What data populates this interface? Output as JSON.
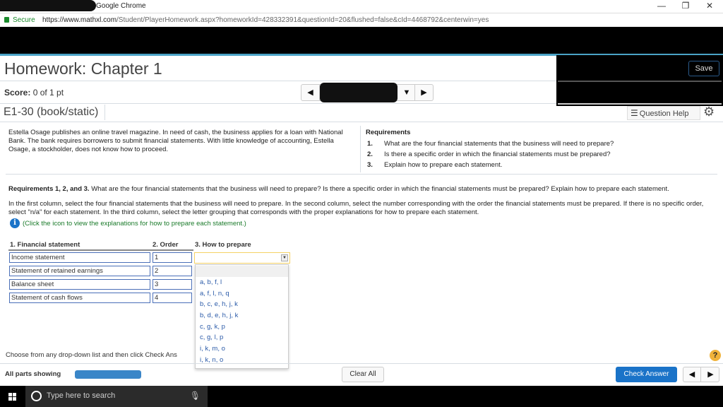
{
  "browser": {
    "window_title": "Google Chrome",
    "secure_label": "Secure",
    "url_domain": "https://www.mathxl.com",
    "url_path": "/Student/PlayerHomework.aspx?homeworkId=428332391&questionId=20&flushed=false&cId=4468792&centerwin=yes",
    "controls": {
      "minimize": "—",
      "restore": "❐",
      "close": "✕"
    }
  },
  "header": {
    "title": "Homework: Chapter 1",
    "save_label": "Save",
    "score_label": "Score:",
    "score_value": "0 of 1 pt",
    "question_id": "E1-30 (book/static)",
    "question_help_label": "Question Help",
    "question_help_icon": "list-icon",
    "settings_icon": "gear-icon",
    "prev_icon": "◀",
    "next_icon": "▶",
    "dropdown_icon": "▼"
  },
  "problem": {
    "story": "Estella Osage publishes an online travel magazine. In need of cash, the business applies for a loan with National Bank. The bank requires borrowers to submit financial statements. With little knowledge of accounting, Estella Osage, a stockholder, does not know how to proceed.",
    "requirements_title": "Requirements",
    "requirements": [
      {
        "num": "1.",
        "text": "What are the four financial statements that the business will need to prepare?"
      },
      {
        "num": "2.",
        "text": "Is there a specific order in which the financial statements must be prepared?"
      },
      {
        "num": "3.",
        "text": "Explain how to prepare each statement."
      }
    ],
    "prompt_bold": "Requirements 1, 2, and 3.",
    "prompt_text": " What are the four financial statements that the business will need to prepare? Is there a specific order in which the financial statements must be prepared? Explain how to prepare each statement.",
    "instructions": "In the first column, select the four financial statements that the business will need to prepare. In the second column, select the number corresponding with the order the financial statements must be prepared. If there is no specific order, select \"n/a\" for each statement. In the third column, select the letter grouping that corresponds with the proper explanations for how to prepare each statement.",
    "info_icon_glyph": "i",
    "info_link": "(Click the icon to view the explanations for how to prepare each statement.)"
  },
  "table": {
    "headers": [
      "1. Financial statement",
      "2. Order",
      "3. How to prepare"
    ],
    "rows": [
      {
        "statement": "Income statement",
        "order": "1",
        "how": ""
      },
      {
        "statement": "Statement of retained earnings",
        "order": "2",
        "how": ""
      },
      {
        "statement": "Balance sheet",
        "order": "3",
        "how": ""
      },
      {
        "statement": "Statement of cash flows",
        "order": "4",
        "how": ""
      }
    ],
    "dropdown_options": [
      "",
      "a, b, f, l",
      "a, f, l, n, q",
      "b, c, e, h, j, k",
      "b, d, e, h, j, k",
      "c, g, k, p",
      "c, g, l, p",
      "i, k, m, o",
      "i, k, n, o"
    ]
  },
  "footer": {
    "choose_text": "Choose from any drop-down list and then click Check Ans",
    "help_glyph": "?",
    "all_parts_label": "All parts showing",
    "progress_fraction": 1.0,
    "clear_all_label": "Clear All",
    "check_answer_label": "Check Answer",
    "prev_glyph": "◀",
    "next_glyph": "▶"
  },
  "taskbar": {
    "search_placeholder": "Type here to search",
    "mic_glyph": "🎙"
  }
}
